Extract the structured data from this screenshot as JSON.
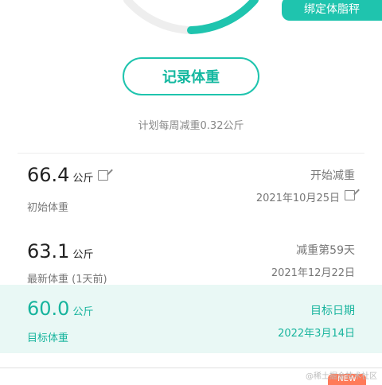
{
  "header": {
    "bind_scale_label": "绑定体脂秤"
  },
  "actions": {
    "record_weight_label": "记录体重"
  },
  "plan": {
    "text": "计划每周减重0.32公斤"
  },
  "initial": {
    "value": "66.4",
    "unit": "公斤",
    "label": "初始体重",
    "right_title": "开始减重",
    "right_date": "2021年10月25日"
  },
  "latest": {
    "value": "63.1",
    "unit": "公斤",
    "label": "最新体重 (1天前)",
    "right_title": "减重第59天",
    "right_date": "2021年12月22日"
  },
  "target": {
    "value": "60.0",
    "unit": "公斤",
    "label": "目标体重",
    "right_title": "目标日期",
    "right_date": "2022年3月14日"
  },
  "footer": {
    "new_badge": "NEW",
    "watermark": "@稀土掘金技术社区"
  },
  "colors": {
    "accent": "#1fc4ae",
    "accent_light": "#e9f8f5",
    "badge": "#ff7a59"
  }
}
